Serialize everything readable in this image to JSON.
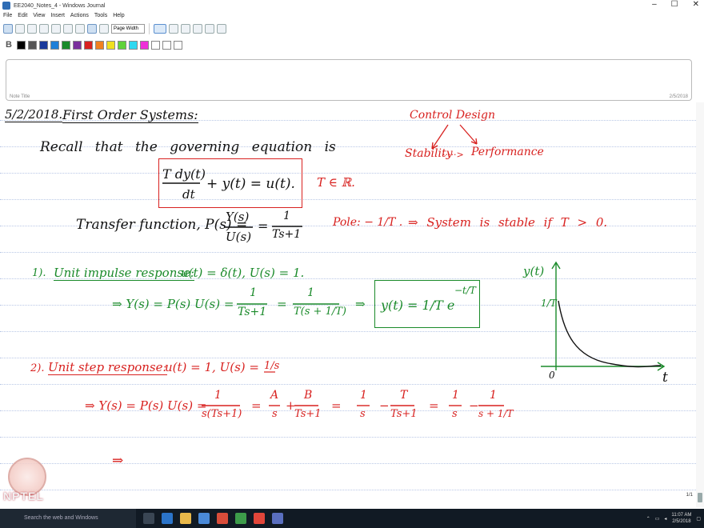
{
  "window": {
    "title": "EE2040_Notes_4 - Windows Journal",
    "controls": [
      "–",
      "☐",
      "✕"
    ]
  },
  "menu": [
    "File",
    "Edit",
    "View",
    "Insert",
    "Actions",
    "Tools",
    "Help"
  ],
  "toolbar": {
    "zoom_select": "Page Width"
  },
  "colorbar": {
    "bold_label": "B",
    "swatches": [
      "#000000",
      "#555555",
      "#1a3a9c",
      "#1e7fd8",
      "#1a8a2a",
      "#7a2f9c",
      "#d8211f",
      "#f08020",
      "#f0e020",
      "#5fd23a",
      "#2fd8f0",
      "#ee2fd8",
      "#ffffff",
      "#ffffff",
      "#ffffff"
    ]
  },
  "note": {
    "title_label": "Note Title",
    "date": "2/5/2018"
  },
  "page": {
    "date_heading": "5/2/2018.",
    "heading": "First Order Systems:",
    "recall": "Recall that the governing equation is",
    "eq_num": "T dy(t)",
    "eq_den": "dt",
    "eq_rest": "+ y(t) = u(t).",
    "t_real": "T ∈ ℝ.",
    "control_design": "Control Design",
    "stability": "Stability",
    "dots": "·····>",
    "performance": "Performance",
    "tf_label": "Transfer function, P(s) =",
    "tf_frac_num": "Y(s)",
    "tf_frac_den": "U(s)",
    "tf_eq": "=",
    "tf_one": "1",
    "tf_den": "Ts+1",
    "pole": "Pole: − 1/T .",
    "stable": "⇒ System is stable if T > 0.",
    "impulse_num": "1).",
    "impulse_title": "Unit impulse response:",
    "impulse_input": "u(t) = δ(t),   U(s) = 1.",
    "impulse_lhs": "⇒ Y(s) = P(s) U(s) =",
    "impulse_frac1_num": "1",
    "impulse_frac1_den": "Ts+1",
    "impulse_eq": "=",
    "impulse_frac2_num": "1",
    "impulse_frac2_den": "T(s + 1/T)",
    "impulse_arrow": "⇒",
    "impulse_result": "y(t) = 1/T e",
    "impulse_exp": "−t/T",
    "graph_ylabel": "y(t)",
    "graph_tick": "1/T",
    "graph_origin": "0",
    "graph_xlabel": "t",
    "step_num": "2).",
    "step_title": "Unit step response:",
    "step_input": "u(t) = 1,   U(s) =",
    "step_input_frac": "1/s",
    "step_lhs": "⇒ Y(s) = P(s) U(s) =",
    "step_f1_num": "1",
    "step_f1_den": "s(Ts+1)",
    "step_eq1": "=",
    "step_f2_num": "A",
    "step_f2_den": "s",
    "step_plus": "+",
    "step_f3_num": "B",
    "step_f3_den": "Ts+1",
    "step_eq2": "=",
    "step_f4_num": "1",
    "step_f4_den": "s",
    "step_minus": "−",
    "step_f5_num": "T",
    "step_f5_den": "Ts+1",
    "step_eq3": "=",
    "step_f6_num": "1",
    "step_f6_den": "s",
    "step_minus2": "−",
    "step_f7_num": "1",
    "step_f7_den": "s + 1/T",
    "step_next": "⇒",
    "page_counter": "1/1"
  },
  "taskbar": {
    "search_placeholder": "Search the web and Windows",
    "time": "11:07 AM",
    "date": "2/5/2018"
  },
  "watermark": {
    "text": "NPTEL"
  },
  "colors": {
    "ink_black": "#111111",
    "ink_red": "#d8211f",
    "ink_green": "#1a8a2a"
  }
}
